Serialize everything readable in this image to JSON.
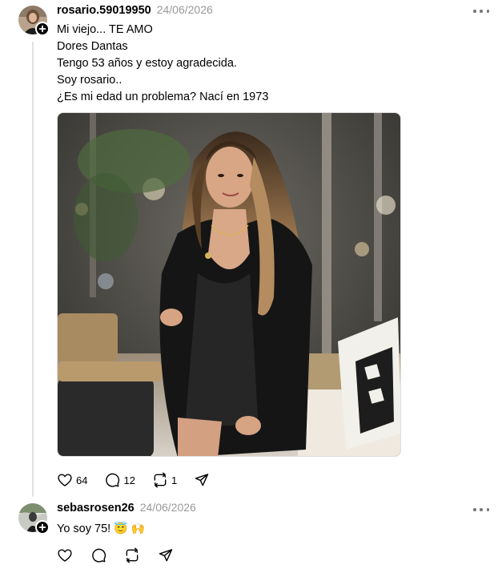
{
  "post": {
    "username": "rosario.59019950",
    "date": "24/06/2026",
    "lines": [
      "Mi viejo... TE AMO",
      "Dores Dantas",
      "Tengo 53 años y estoy agradecida.",
      "Soy rosario..",
      "¿Es mi edad un problema? Nací en 1973"
    ],
    "likes": "64",
    "comments": "12",
    "reposts": "1"
  },
  "reply": {
    "username": "sebasrosen26",
    "date": "24/06/2026",
    "text": "Yo soy 75!",
    "emoji1": "😇",
    "emoji2": "🙌"
  },
  "colors": {
    "accent": "#000000",
    "muted": "#999999",
    "thread_line": "#e2e2e2"
  },
  "icons": [
    "plus-icon",
    "more-icon",
    "heart-icon",
    "comment-icon",
    "repost-icon",
    "share-icon"
  ]
}
